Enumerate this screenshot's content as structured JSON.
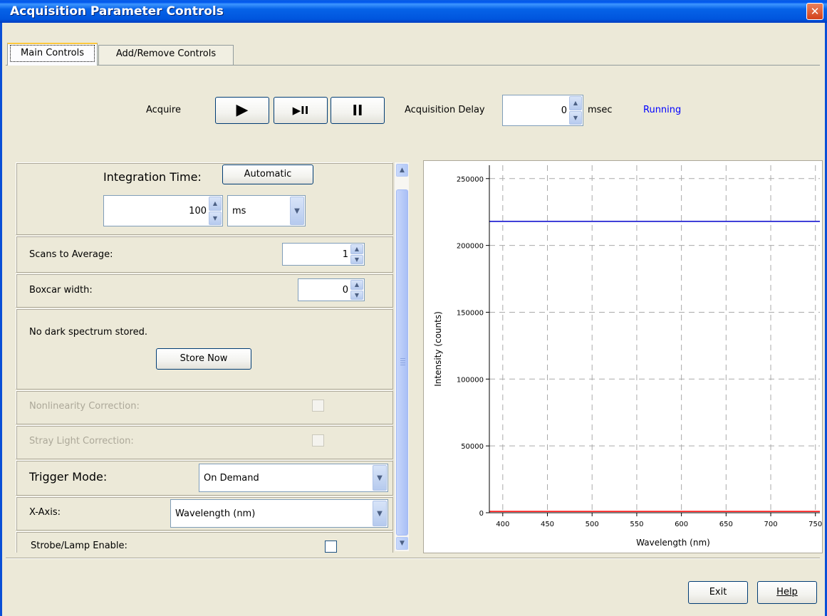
{
  "window": {
    "title": "Acquisition Parameter Controls",
    "close_glyph": "✕"
  },
  "tabs": [
    {
      "label": "Main Controls",
      "active": true
    },
    {
      "label": "Add/Remove Controls",
      "active": false
    }
  ],
  "acquire": {
    "label": "Acquire",
    "play_glyph": "▶",
    "play_pause_glyph": "▶II",
    "pause_glyph": "II",
    "delay_label": "Acquisition Delay",
    "delay_value": "0",
    "delay_unit": "msec",
    "status": "Running"
  },
  "integration": {
    "label": "Integration Time:",
    "auto_button": "Automatic",
    "value": "100",
    "unit": "ms"
  },
  "scans": {
    "label": "Scans to Average:",
    "value": "1"
  },
  "boxcar": {
    "label": "Boxcar width:",
    "value": "0"
  },
  "dark": {
    "message": "No dark spectrum stored.",
    "button": "Store Now"
  },
  "nonlinearity": {
    "label": "Nonlinearity Correction:",
    "checked": false,
    "enabled": false
  },
  "stray_light": {
    "label": "Stray Light Correction:",
    "checked": false,
    "enabled": false
  },
  "trigger": {
    "label": "Trigger Mode:",
    "value": "On Demand"
  },
  "xaxis": {
    "label": "X-Axis:",
    "value": "Wavelength (nm)"
  },
  "strobe": {
    "label": "Strobe/Lamp Enable:",
    "checked": false
  },
  "buttons": {
    "exit": "Exit",
    "help": "Help"
  },
  "colors": {
    "title_bar": "#0055DD",
    "status": "#0000FF",
    "series_blue": "#0000CC",
    "series_red": "#FF0000",
    "grid": "#AAAAAA"
  },
  "chart_data": {
    "type": "line",
    "xlabel": "Wavelength (nm)",
    "ylabel": "Intensity (counts)",
    "xlim": [
      385,
      755
    ],
    "ylim": [
      0,
      260000
    ],
    "xticks": [
      400,
      450,
      500,
      550,
      600,
      650,
      700,
      750
    ],
    "yticks": [
      0,
      50000,
      100000,
      150000,
      200000,
      250000
    ],
    "grid": true,
    "series": [
      {
        "color": "#0000CC",
        "x": [
          385,
          755
        ],
        "y": [
          218000,
          218000
        ]
      },
      {
        "color": "#FF0000",
        "x": [
          385,
          755
        ],
        "y": [
          1000,
          1000
        ]
      }
    ]
  }
}
